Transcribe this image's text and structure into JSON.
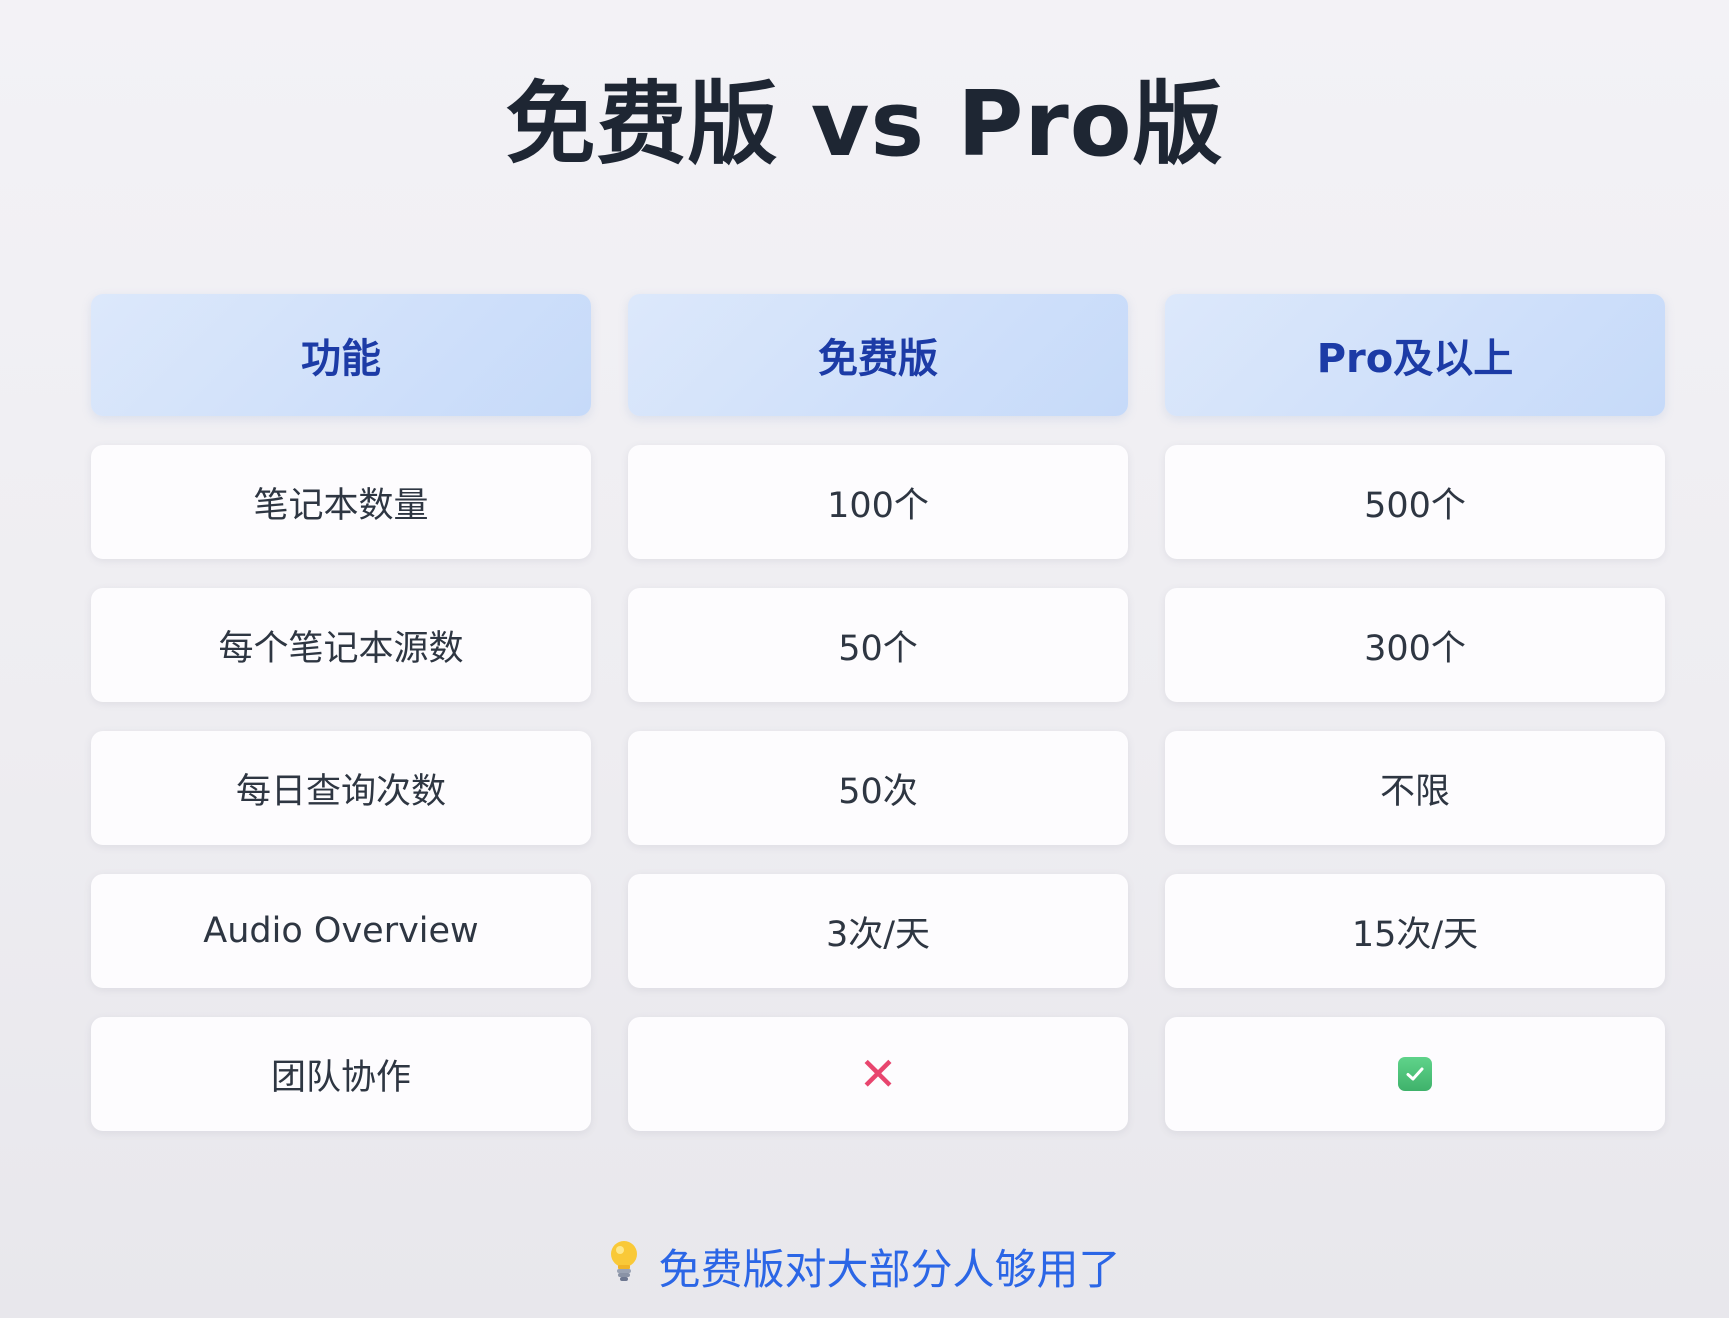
{
  "title": "免费版 vs Pro版",
  "table": {
    "headers": [
      "功能",
      "免费版",
      "Pro及以上"
    ],
    "rows": [
      [
        "笔记本数量",
        "100个",
        "500个"
      ],
      [
        "每个笔记本源数",
        "50个",
        "300个"
      ],
      [
        "每日查询次数",
        "50次",
        "不限"
      ],
      [
        "Audio Overview",
        "3次/天",
        "15次/天"
      ],
      [
        "团队协作",
        "",
        ""
      ]
    ],
    "team_collab_icons": {
      "free": "cross-mark-icon",
      "pro": "check-mark-icon"
    }
  },
  "footer": {
    "icon": "lightbulb-icon",
    "text": "免费版对大部分人够用了"
  },
  "colors": {
    "header_text": "#1c3ba6",
    "footer_text": "#2b66e6",
    "cross": "#e8456e",
    "check": "#3fb26b"
  }
}
